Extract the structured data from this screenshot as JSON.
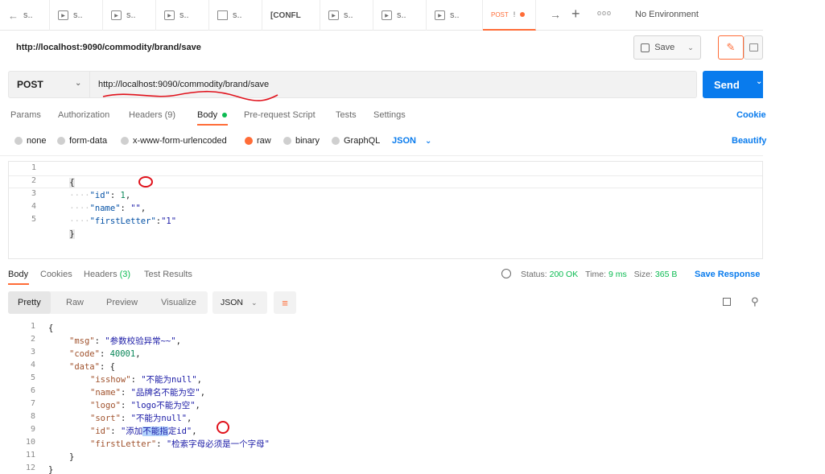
{
  "tabs": [
    {
      "label": "s..",
      "icon": "arrow-left-icon"
    },
    {
      "label": "s..",
      "icon": "play-icon"
    },
    {
      "label": "s..",
      "icon": "play-icon"
    },
    {
      "label": "s..",
      "icon": "play-icon"
    },
    {
      "label": "s..",
      "icon": "doc-icon"
    },
    {
      "label": "[CONFL",
      "icon": ""
    },
    {
      "label": "s..",
      "icon": "play-icon"
    },
    {
      "label": "s..",
      "icon": "play-icon"
    },
    {
      "label": "s..",
      "icon": "play-icon"
    },
    {
      "label": "POST",
      "suffix": "!",
      "icon": ""
    }
  ],
  "environment": "No Environment",
  "request": {
    "title": "http://localhost:9090/commodity/brand/save",
    "save_label": "Save",
    "method": "POST",
    "url": "http://localhost:9090/commodity/brand/save",
    "send_label": "Send"
  },
  "request_tabs": {
    "params": "Params",
    "authorization": "Authorization",
    "headers": "Headers",
    "headers_count": "(9)",
    "body": "Body",
    "prerequest": "Pre-request Script",
    "tests": "Tests",
    "settings": "Settings",
    "cookies": "Cookie"
  },
  "body_types": {
    "none": "none",
    "form_data": "form-data",
    "urlencoded": "x-www-form-urlencoded",
    "raw": "raw",
    "binary": "binary",
    "graphql": "GraphQL",
    "format": "JSON",
    "beautify": "Beautify"
  },
  "request_body": {
    "line_numbers": [
      "1",
      "2",
      "3",
      "4",
      "5"
    ],
    "open": "{",
    "close": "}",
    "fields": [
      {
        "key": "\"id\"",
        "sep": ": ",
        "value": "1",
        "end": ","
      },
      {
        "key": "\"name\"",
        "sep": ": ",
        "value": "\"\"",
        "end": ","
      },
      {
        "key": "\"firstLetter\"",
        "sep": ":",
        "value": "\"1\"",
        "end": ""
      }
    ]
  },
  "response_tabs": {
    "body": "Body",
    "cookies": "Cookies",
    "headers": "Headers",
    "headers_count": "(3)",
    "test_results": "Test Results"
  },
  "response_status": {
    "status_label": "Status:",
    "status_value": "200 OK",
    "time_label": "Time:",
    "time_value": "9 ms",
    "size_label": "Size:",
    "size_value": "365 B",
    "save_response": "Save Response"
  },
  "view_tabs": {
    "pretty": "Pretty",
    "raw": "Raw",
    "preview": "Preview",
    "visualize": "Visualize",
    "format": "JSON"
  },
  "response_body": {
    "line_numbers": [
      "1",
      "2",
      "3",
      "4",
      "5",
      "6",
      "7",
      "8",
      "9",
      "10",
      "11",
      "12"
    ],
    "lines": [
      {
        "indent": 0,
        "parts": [
          {
            "t": "{",
            "c": "punc"
          }
        ]
      },
      {
        "indent": 1,
        "parts": [
          {
            "t": "\"msg\"",
            "c": "key"
          },
          {
            "t": ": ",
            "c": "punc"
          },
          {
            "t": "\"参数校验异常~~\"",
            "c": "str"
          },
          {
            "t": ",",
            "c": "punc"
          }
        ]
      },
      {
        "indent": 1,
        "parts": [
          {
            "t": "\"code\"",
            "c": "key"
          },
          {
            "t": ": ",
            "c": "punc"
          },
          {
            "t": "40001",
            "c": "num"
          },
          {
            "t": ",",
            "c": "punc"
          }
        ]
      },
      {
        "indent": 1,
        "parts": [
          {
            "t": "\"data\"",
            "c": "key"
          },
          {
            "t": ": {",
            "c": "punc"
          }
        ]
      },
      {
        "indent": 2,
        "parts": [
          {
            "t": "\"isshow\"",
            "c": "key"
          },
          {
            "t": ": ",
            "c": "punc"
          },
          {
            "t": "\"不能为null\"",
            "c": "str"
          },
          {
            "t": ",",
            "c": "punc"
          }
        ]
      },
      {
        "indent": 2,
        "parts": [
          {
            "t": "\"name\"",
            "c": "key"
          },
          {
            "t": ": ",
            "c": "punc"
          },
          {
            "t": "\"品牌名不能为空\"",
            "c": "str"
          },
          {
            "t": ",",
            "c": "punc"
          }
        ]
      },
      {
        "indent": 2,
        "parts": [
          {
            "t": "\"logo\"",
            "c": "key"
          },
          {
            "t": ": ",
            "c": "punc"
          },
          {
            "t": "\"logo不能为空\"",
            "c": "str"
          },
          {
            "t": ",",
            "c": "punc"
          }
        ]
      },
      {
        "indent": 2,
        "parts": [
          {
            "t": "\"sort\"",
            "c": "key"
          },
          {
            "t": ": ",
            "c": "punc"
          },
          {
            "t": "\"不能为null\"",
            "c": "str"
          },
          {
            "t": ",",
            "c": "punc"
          }
        ]
      },
      {
        "indent": 2,
        "parts": [
          {
            "t": "\"id\"",
            "c": "key"
          },
          {
            "t": ": ",
            "c": "punc"
          },
          {
            "t": "\"添加",
            "c": "str"
          },
          {
            "t": "不能指",
            "c": "str-hl"
          },
          {
            "t": "定id\"",
            "c": "str"
          },
          {
            "t": ",",
            "c": "punc"
          }
        ]
      },
      {
        "indent": 2,
        "parts": [
          {
            "t": "\"firstLetter\"",
            "c": "key"
          },
          {
            "t": ": ",
            "c": "punc"
          },
          {
            "t": "\"检索字母必须是一个字母\"",
            "c": "str"
          }
        ]
      },
      {
        "indent": 1,
        "parts": [
          {
            "t": "}",
            "c": "punc"
          }
        ]
      },
      {
        "indent": 0,
        "parts": [
          {
            "t": "}",
            "c": "punc"
          }
        ]
      }
    ]
  },
  "colors": {
    "accent": "#ff6c37",
    "send": "#097bed",
    "status_ok": "#0cbb52",
    "annotation": "#e0121c"
  }
}
